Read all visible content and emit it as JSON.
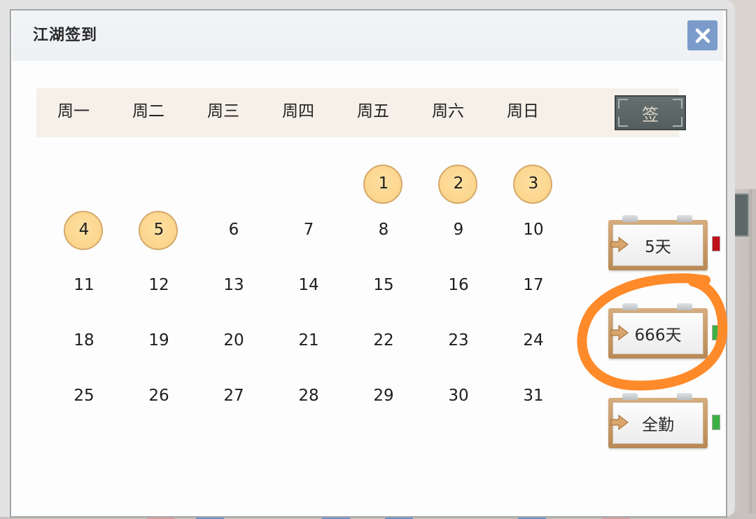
{
  "dialog": {
    "title": "江湖签到",
    "close_icon": "close-icon"
  },
  "calendar": {
    "weekdays": [
      "周一",
      "周二",
      "周三",
      "周四",
      "周五",
      "周六",
      "周日"
    ],
    "sign_button_label": "签",
    "first_weekday_index": 4,
    "days_in_month": 31,
    "signed_days": [
      1,
      2,
      3,
      4,
      5
    ],
    "days": [
      "1",
      "2",
      "3",
      "4",
      "5",
      "6",
      "7",
      "8",
      "9",
      "10",
      "11",
      "12",
      "13",
      "14",
      "15",
      "16",
      "17",
      "18",
      "19",
      "20",
      "21",
      "22",
      "23",
      "24",
      "25",
      "26",
      "27",
      "28",
      "29",
      "30",
      "31"
    ]
  },
  "rewards": [
    {
      "label": "5天",
      "indicator": "red",
      "indicator_color": "#c0101a"
    },
    {
      "label": "666天",
      "indicator": "green",
      "indicator_color": "#3cb043"
    },
    {
      "label": "全勤",
      "indicator": "green",
      "indicator_color": "#3cb043"
    }
  ],
  "colors": {
    "header_bg": "#f5f0e8",
    "signed_fill": "#fbd58c",
    "close_bg": "#7b9ccb",
    "annotation": "#ff8a2a"
  }
}
